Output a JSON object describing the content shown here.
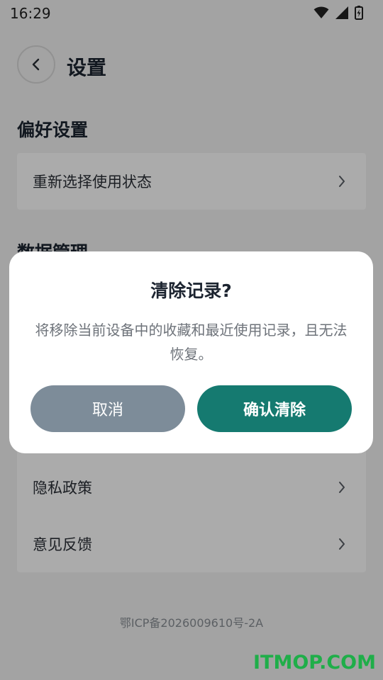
{
  "status_bar": {
    "time": "16:29"
  },
  "header": {
    "title": "设置"
  },
  "sections": {
    "preferences": {
      "title": "偏好设置",
      "items": [
        {
          "label": "重新选择使用状态"
        }
      ]
    },
    "data_management": {
      "title": "数据管理"
    },
    "other_items": [
      {
        "label": "隐私政策"
      },
      {
        "label": "意见反馈"
      }
    ]
  },
  "footer": {
    "icp": "鄂ICP备2026009610号-2A"
  },
  "dialog": {
    "title": "清除记录?",
    "message": "将移除当前设备中的收藏和最近使用记录，且无法恢复。",
    "cancel_label": "取消",
    "confirm_label": "确认清除"
  },
  "watermark": "ITMOP.COM",
  "colors": {
    "primary": "#157a70",
    "cancel": "#7d8c99",
    "background": "#f3f3f3",
    "watermark": "#1fae49"
  },
  "icons": {
    "wifi": "wifi-icon",
    "signal": "signal-icon",
    "battery": "battery-charging-icon",
    "back": "chevron-left-icon",
    "row_arrow": "chevron-right-icon"
  }
}
